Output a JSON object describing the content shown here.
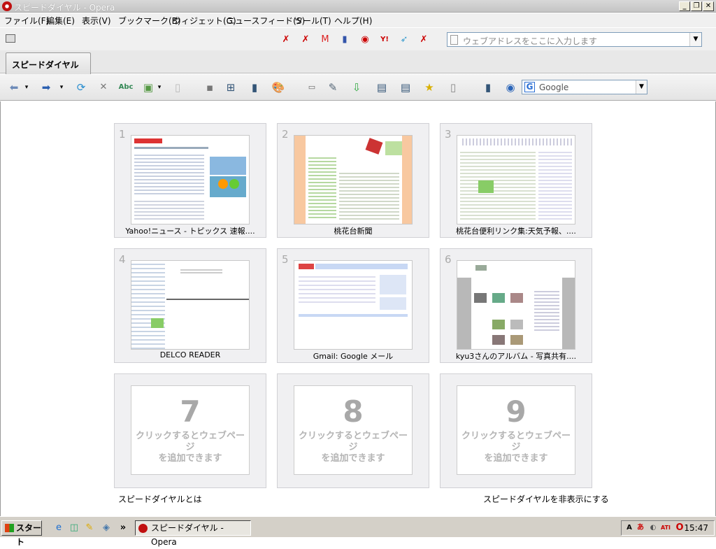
{
  "window": {
    "title": "スピードダイヤル - Opera"
  },
  "menu": [
    "ファイル(F)",
    "編集(E)",
    "表示(V)",
    "ブックマーク(B)",
    "ウィジェット(G)",
    "ニュースフィード(S)",
    "ツール(T)",
    "ヘルプ(H)"
  ],
  "address": {
    "placeholder": "ウェブアドレスをここに入力します"
  },
  "tab": {
    "label": "スピードダイヤル"
  },
  "search": {
    "engine": "Google"
  },
  "dials": [
    {
      "n": "1",
      "caption": "Yahoo!ニュース - トピックス 速報...."
    },
    {
      "n": "2",
      "caption": "桃花台新聞"
    },
    {
      "n": "3",
      "caption": "桃花台便利リンク集:天気予報、...."
    },
    {
      "n": "4",
      "caption": "DELCO READER"
    },
    {
      "n": "5",
      "caption": "Gmail: Google メール"
    },
    {
      "n": "6",
      "caption": "kyu3さんのアルバム - 写真共有...."
    },
    {
      "n": "7",
      "hint1": "クリックするとウェブページ",
      "hint2": "を追加できます"
    },
    {
      "n": "8",
      "hint1": "クリックするとウェブページ",
      "hint2": "を追加できます"
    },
    {
      "n": "9",
      "hint1": "クリックするとウェブページ",
      "hint2": "を追加できます"
    }
  ],
  "links": {
    "about": "スピードダイヤルとは",
    "hide": "スピードダイヤルを非表示にする"
  },
  "taskbar": {
    "start": "スタート",
    "task": "スピードダイヤル - Opera",
    "clock": "15:47",
    "more": "»"
  },
  "colors": {
    "accent": "#2b6fd4",
    "empty_text": "#a8a8a8"
  }
}
